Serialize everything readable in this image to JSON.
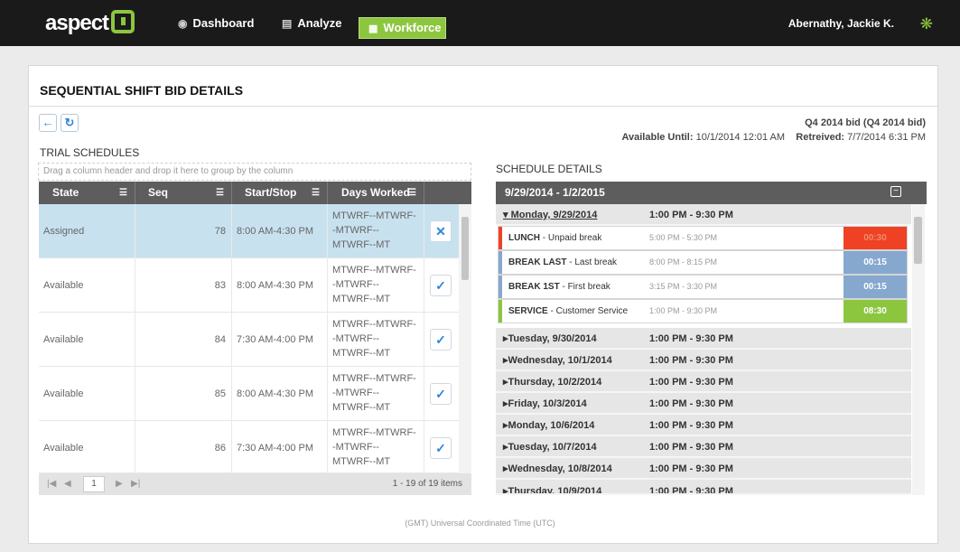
{
  "topbar": {
    "logo": "aspect",
    "nav": [
      {
        "label": "Dashboard",
        "icon": "dashboard-icon"
      },
      {
        "label": "Analyze",
        "icon": "chart-icon"
      },
      {
        "label": "Workforce",
        "icon": "calendar-icon",
        "active": true
      }
    ],
    "user": "Abernathy, Jackie K.",
    "accent": "#8cc63f"
  },
  "page": {
    "title": "SEQUENTIAL SHIFT BID DETAILS",
    "bid_name": "Q4 2014 bid (Q4 2014 bid)",
    "available_until_label": "Available Until:",
    "available_until": "10/1/2014  12:01 AM",
    "retreived_label": "Retreived:",
    "retreived": "7/7/2014  6:31 PM",
    "footer": "(GMT) Universal Coordinated Time (UTC)"
  },
  "trial": {
    "label": "TRIAL SCHEDULES",
    "group_hint": "Drag a column header and drop it here to group by the column",
    "columns": [
      "State",
      "Seq",
      "Start/Stop",
      "Days Worked"
    ],
    "rows": [
      {
        "state": "Assigned",
        "seq": "78",
        "time": "8:00 AM-4:30 PM",
        "days": "MTWRF--MTWRF--MTWRF--MTWRF--MT",
        "action": "✕",
        "selected": true
      },
      {
        "state": "Available",
        "seq": "83",
        "time": "8:00 AM-4:30 PM",
        "days": "MTWRF--MTWRF--MTWRF--MTWRF--MT",
        "action": "✓"
      },
      {
        "state": "Available",
        "seq": "84",
        "time": "7:30 AM-4:00 PM",
        "days": "MTWRF--MTWRF--MTWRF--MTWRF--MT",
        "action": "✓"
      },
      {
        "state": "Available",
        "seq": "85",
        "time": "8:00 AM-4:30 PM",
        "days": "MTWRF--MTWRF--MTWRF--MTWRF--MT",
        "action": "✓"
      },
      {
        "state": "Available",
        "seq": "86",
        "time": "7:30 AM-4:00 PM",
        "days": "MTWRF--MTWRF--MTWRF--MTWRF--MT",
        "action": "✓"
      }
    ],
    "pager": {
      "current": "1",
      "count": "1 - 19 of 19 items"
    }
  },
  "details": {
    "label": "SCHEDULE DETAILS",
    "range": "9/29/2014 - 1/2/2015",
    "open_day": {
      "name": "Monday, 9/29/2014",
      "time": "1:00 PM - 9:30 PM"
    },
    "breaks": [
      {
        "name": "LUNCH",
        "desc": " - Unpaid break",
        "time": "5:00 PM - 5:30 PM",
        "dur": "00:30",
        "color": "#ef4123",
        "text_color": "#f38a6e"
      },
      {
        "name": "BREAK LAST",
        "desc": " - Last break",
        "time": "8:00 PM - 8:15 PM",
        "dur": "00:15",
        "color": "#86a8cf",
        "text_color": "#ffffff"
      },
      {
        "name": "BREAK 1ST",
        "desc": " - First break",
        "time": "3:15 PM - 3:30 PM",
        "dur": "00:15",
        "color": "#86a8cf",
        "text_color": "#ffffff"
      },
      {
        "name": "SERVICE",
        "desc": " - Customer Service",
        "time": "1:00 PM - 9:30 PM",
        "dur": "08:30",
        "color": "#8cc63f",
        "text_color": "#ffffff"
      }
    ],
    "days": [
      {
        "name": "Tuesday, 9/30/2014",
        "time": "1:00 PM - 9:30 PM"
      },
      {
        "name": "Wednesday, 10/1/2014",
        "time": "1:00 PM - 9:30 PM"
      },
      {
        "name": "Thursday, 10/2/2014",
        "time": "1:00 PM - 9:30 PM"
      },
      {
        "name": "Friday, 10/3/2014",
        "time": "1:00 PM - 9:30 PM"
      },
      {
        "name": "Monday, 10/6/2014",
        "time": "1:00 PM - 9:30 PM"
      },
      {
        "name": "Tuesday, 10/7/2014",
        "time": "1:00 PM - 9:30 PM"
      },
      {
        "name": "Wednesday, 10/8/2014",
        "time": "1:00 PM - 9:30 PM"
      },
      {
        "name": "Thursday, 10/9/2014",
        "time": "1:00 PM - 9:30 PM"
      }
    ]
  }
}
